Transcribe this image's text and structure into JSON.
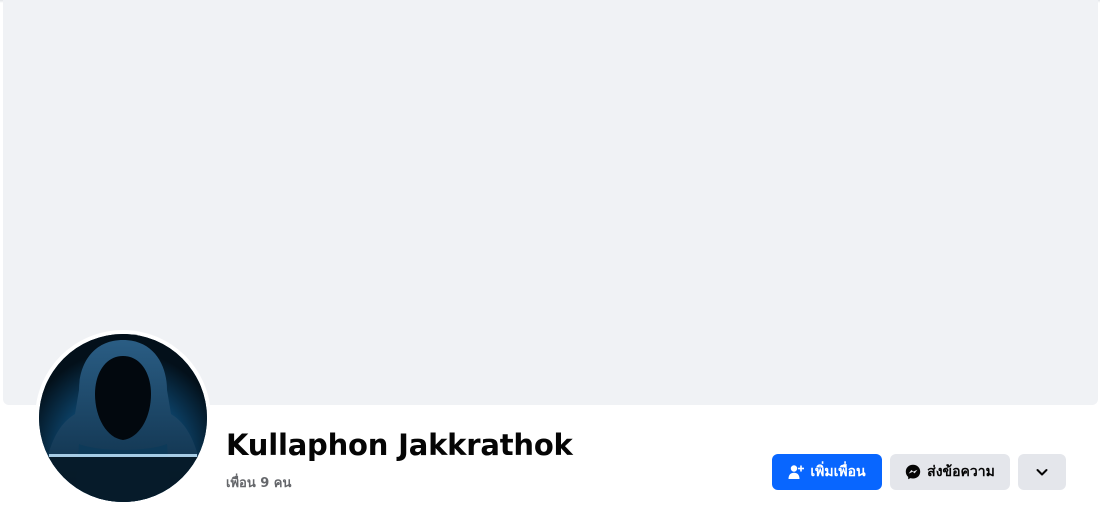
{
  "profile": {
    "name": "Kullaphon Jakkrathok",
    "friends_count_label": "เพื่อน 9 คน",
    "avatar_icon": "hooded-hacker-avatar"
  },
  "actions": {
    "add_friend_label": "เพิ่มเพื่อน",
    "add_friend_icon": "add-friend-icon",
    "message_label": "ส่งข้อความ",
    "message_icon": "messenger-icon",
    "more_icon": "chevron-down-icon"
  },
  "colors": {
    "primary": "#0866ff",
    "secondary_button": "#e4e6eb",
    "cover": "#f0f2f5",
    "secondary_text": "#65676b"
  }
}
